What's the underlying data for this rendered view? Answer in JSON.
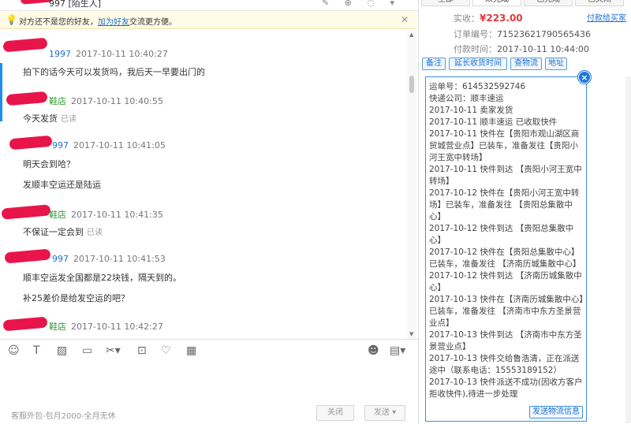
{
  "chat": {
    "title": "997 [陌生人]",
    "notice": {
      "prefix": "对方还不是您的好友，",
      "link": "加为好友",
      "suffix": "交流更方便。"
    },
    "messages": [
      {
        "name": "1997",
        "time": "2017-10-11 10:40:27",
        "lines": [
          "拍下的话今天可以发货吗，我后天一早要出门的"
        ],
        "read": ""
      },
      {
        "name": "鞋店",
        "time": "2017-10-11 10:40:55",
        "lines": [
          "今天发货"
        ],
        "read": "已读"
      },
      {
        "name": "997",
        "time": "2017-10-11 10:41:05",
        "lines": [
          "明天会到哈？",
          "发顺丰空运还是陆运"
        ],
        "read": ""
      },
      {
        "name": "鞋店",
        "time": "2017-10-11 10:41:35",
        "lines": [
          "不保证一定会到"
        ],
        "read": "已读"
      },
      {
        "name": "997",
        "time": "2017-10-11 10:41:53",
        "lines": [
          "顺丰空运发全国都是22块钱，隔天到的。",
          "补25差价是给发空运的吧？"
        ],
        "read": ""
      },
      {
        "name": "鞋店",
        "time": "2017-10-11 10:42:27",
        "lines": [],
        "read": ""
      }
    ],
    "toolbar_icons": [
      "emoji-icon",
      "text-format-icon",
      "image-icon",
      "folder-icon",
      "scissors-icon",
      "shake-icon",
      "heart-icon",
      "calculator-icon"
    ],
    "status_text": "客服外包-包月2000-全月无休",
    "close_label": "关闭",
    "send_label": "发送"
  },
  "order": {
    "tabs": [
      "全部",
      "未完成",
      "已完成",
      "已关闭"
    ],
    "paid_label": "实收：",
    "paid_value": "¥223.00",
    "pay_link": "付款给买家",
    "order_no_label": "订单编号：",
    "order_no": "71523621790565436",
    "pay_time_label": "付款时间：",
    "pay_time": "2017-10-11 10:44:00",
    "actions": [
      "备注",
      "延长收货时间",
      "查物流",
      "地址"
    ],
    "logistics": [
      "运单号：614532592746",
      "快递公司：顺丰速运",
      "2017-10-11 卖家发货",
      "2017-10-11 顺丰速运 已收取快件",
      "2017-10-11 快件在【贵阳市观山湖区商贸城营业点】已装车，准备发往【贵阳小河王宽中转场】",
      "2017-10-11 快件到达 【贵阳小河王宽中转场】",
      "2017-10-12 快件在【贵阳小河王宽中转场】已装车，准备发往 【贵阳总集散中心】",
      "2017-10-12 快件到达 【贵阳总集散中心】",
      "2017-10-12 快件在【贵阳总集散中心】已装车，准备发往 【济南历城集散中心】",
      "2017-10-12 快件到达 【济南历城集散中心】",
      "2017-10-13 快件在【济南历城集散中心】已装车，准备发往 【济南市中东方圣景营业点】",
      "2017-10-13 快件到达 【济南市中东方圣景营业点】",
      "2017-10-13 快件交给鲁浩清，正在派送途中（联系电话：15553189152）",
      "2017-10-13 快件派送不成功(因收方客户拒收快件),待进一步处理"
    ],
    "send_logistics_label": "发送物流信息"
  }
}
